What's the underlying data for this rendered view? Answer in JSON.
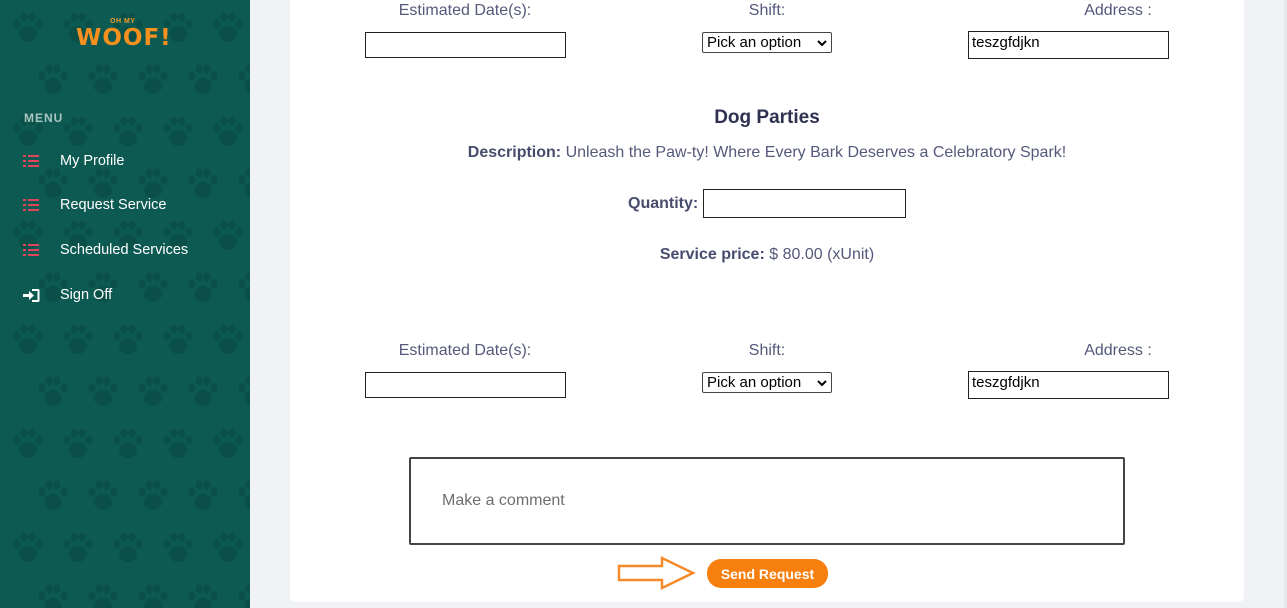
{
  "sidebar": {
    "logo_small": "OH MY",
    "logo_big": "WOOF!",
    "menu_title": "MENU",
    "items": [
      {
        "label": "My Profile",
        "icon": "list-icon"
      },
      {
        "label": "Request Service",
        "icon": "list-icon"
      },
      {
        "label": "Scheduled Services",
        "icon": "list-icon"
      },
      {
        "label": "Sign Off",
        "icon": "sign-in-icon"
      }
    ]
  },
  "top_row": {
    "date_label": "Estimated Date(s):",
    "shift_label": "Shift:",
    "address_label": "Address :",
    "date_value": "",
    "shift_value": "Pick an option",
    "address_value": "teszgfdjkn"
  },
  "service": {
    "title": "Dog Parties",
    "description_label": "Description:",
    "description_text": "Unleash the Paw-ty! Where Every Bark Deserves a Celebratory Spark!",
    "quantity_label": "Quantity:",
    "quantity_value": "",
    "price_label": "Service price:",
    "price_value": "$ 80.00 (xUnit)"
  },
  "bottom_row": {
    "date_label": "Estimated Date(s):",
    "shift_label": "Shift:",
    "address_label": "Address :",
    "date_value": "",
    "shift_value": "Pick an option",
    "address_value": "teszgfdjkn"
  },
  "comment": {
    "placeholder": "Make a comment"
  },
  "send_button": {
    "label": "Send Request"
  },
  "colors": {
    "sidebar": "#0c5a52",
    "accent": "#f77f0d",
    "list_icon": "#e0455a"
  }
}
